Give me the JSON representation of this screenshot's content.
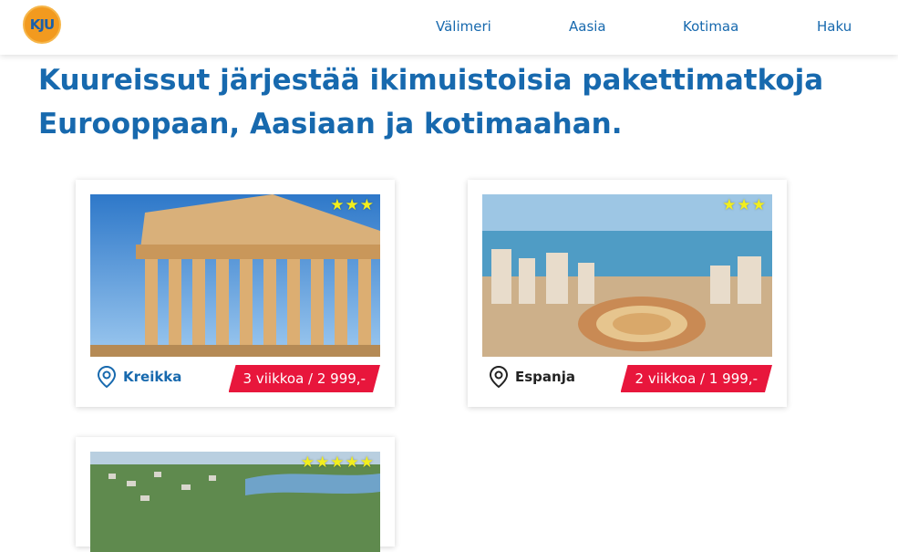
{
  "brand": {
    "logo_text": "KJU"
  },
  "nav": {
    "items": [
      "Välimeri",
      "Aasia",
      "Kotimaa",
      "Haku"
    ]
  },
  "hero": {
    "line1": "Kuureissut järjestää ikimuistoisia pakettimatkoja",
    "line2": "Eurooppaan, Aasiaan ja kotimaahan."
  },
  "cards": [
    {
      "destination": "Kreikka",
      "price": "3 viikkoa / 2 999,-",
      "stars": "★★★",
      "star_rating": 3,
      "image": "parthenon-photo"
    },
    {
      "destination": "Espanja",
      "price": "2 viikkoa / 1 999,-",
      "stars": "★★★",
      "star_rating": 3,
      "image": "coastal-city-bullring-photo"
    },
    {
      "destination": "",
      "price": "",
      "stars": "★★★★★",
      "star_rating": 5,
      "image": "lake-town-aerial-photo"
    }
  ],
  "colors": {
    "brand_blue": "#1769ae",
    "price_red": "#e8163c",
    "star_yellow": "#f2ee1e",
    "logo_orange": "#f29a1f"
  }
}
